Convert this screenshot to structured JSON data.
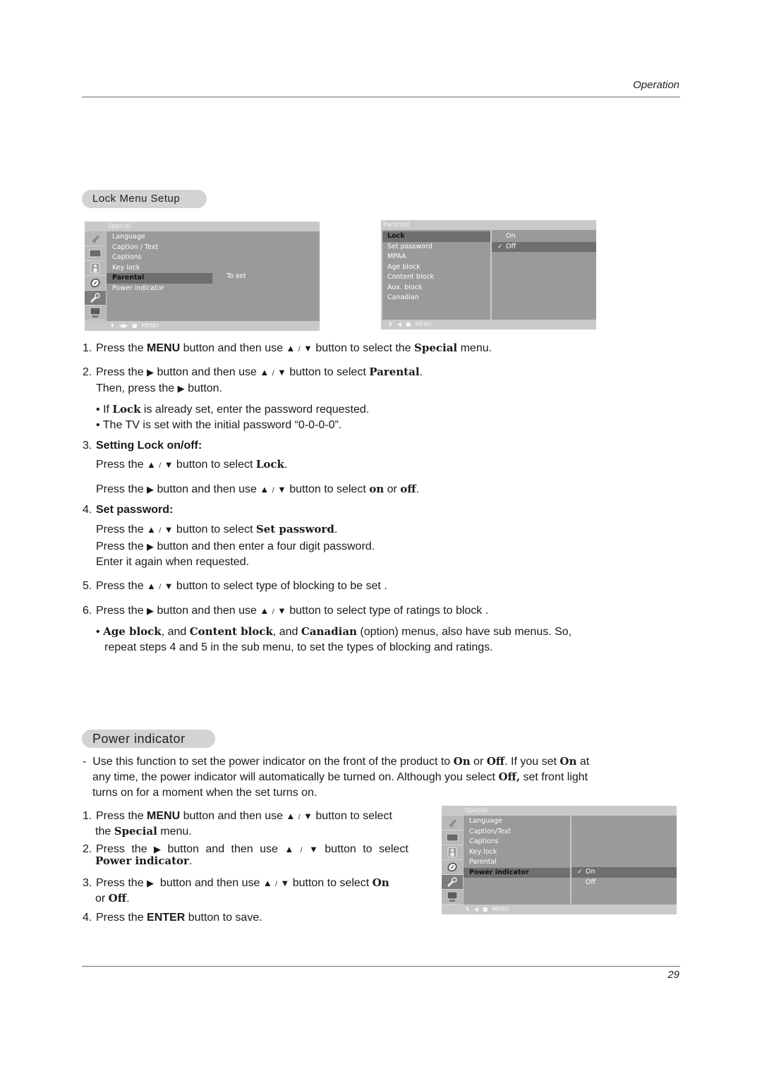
{
  "header": {
    "section": "Operation"
  },
  "footer": {
    "page_number": "29"
  },
  "lock_section": {
    "title": "Lock Menu Setup",
    "menu_special": {
      "title": "Special",
      "icons": [
        "satellite-icon",
        "picture-icon",
        "speaker-icon",
        "time-icon",
        "key-icon",
        "pc-icon"
      ],
      "active_icon_index": 4,
      "items": [
        "Language",
        "Caption / Text",
        "Captions",
        "Key lock",
        "Parental",
        "Power indicator"
      ],
      "selected_index": 4,
      "side_text": "To set",
      "footer": {
        "arrows": "◀▶",
        "stop": "■",
        "label": "MENU"
      }
    },
    "menu_parental": {
      "title": "Parental",
      "items": [
        "Lock",
        "Set password",
        "MPAA",
        "Age block",
        "Content block",
        "Aux. block",
        "Canadian"
      ],
      "selected_index": 0,
      "options": [
        "On",
        "Off"
      ],
      "checked_option_index": 1,
      "footer": {
        "arrows": "◀",
        "stop": "■",
        "label": "MENU"
      }
    },
    "steps": {
      "s1": {
        "n": "1.",
        "a": "Press the ",
        "b1": "MENU",
        "c": " button and then use ",
        "d": " button to select the ",
        "b2": "Special",
        "e": " menu."
      },
      "s2": {
        "n": "2.",
        "a": "Press the ",
        "c": " button and then use ",
        "d": " button to select ",
        "b1": "Parental",
        "e": ".",
        "l2a": "Then, press the ",
        "l2b": " button."
      },
      "bullet1": {
        "a": "If ",
        "b": "Lock",
        "c": " is already set, enter the password requested."
      },
      "bullet2": {
        "a": "The TV is set with the initial password “0-0-0-0”."
      },
      "s3": {
        "n": "3.",
        "heading": "Setting Lock on/off:",
        "l1a": "Press the ",
        "l1b": " button to select ",
        "l1c": "Lock",
        "l1d": ".",
        "l2a": "Press the ",
        "l2b": " button and then use ",
        "l2c": " button to select ",
        "on": "on",
        "or": " or ",
        "off": "off",
        "end": "."
      },
      "s4": {
        "n": "4.",
        "heading": "Set password:",
        "l1a": "Press the ",
        "l1b": " button to select ",
        "l1c": "Set password",
        "l1d": ".",
        "l2a": "Press the ",
        "l2b": " button and then enter a four digit password.",
        "l3": "Enter it again when requested."
      },
      "s5": {
        "n": "5.",
        "a": "Press the ",
        "b": " button to select type of blocking to be set ."
      },
      "s6": {
        "n": "6.",
        "a": "Press the ",
        "b": " button and then use ",
        "c": " button to select type of ratings to block ."
      },
      "bullet3": {
        "b1": "Age block",
        "a": ", and ",
        "b2": "Content block",
        "c": ", and ",
        "b3": "Canadian",
        "d": " (option) menus, also have sub menus. So,",
        "l2": "repeat steps 4 and 5 in the sub menu, to set the types of blocking and ratings."
      }
    }
  },
  "power_section": {
    "title": "Power indicator",
    "intro": {
      "dash": "-",
      "a": "Use this function to set the power indicator on the front of the product to ",
      "on": "On",
      "or": " or ",
      "off": "Off",
      "b": ". If you set ",
      "on2": "On",
      "c": " at",
      "l2a": "any time, the power indicator will automatically be turned on. Although you select ",
      "off2": "Off,",
      "l2b": " set front light",
      "l3": "turns on for a moment when the set turns on."
    },
    "steps": {
      "s1": {
        "n": "1.",
        "a": "Press the ",
        "b": "MENU",
        "c": " button and then use ",
        "d": " button to select",
        "l2a": "the ",
        "l2b": "Special",
        "l2c": " menu."
      },
      "s2": {
        "n": "2.",
        "a": "Press the ",
        "b": " button and then use ",
        "c": " button to select",
        "l2": "Power indicator",
        "l2d": "."
      },
      "s3": {
        "n": "3.",
        "a": "Press the ",
        "b": " button and then use ",
        "c": " button to select ",
        "on": "On",
        "l2a": "or ",
        "off": "Off",
        "l2b": "."
      },
      "s4": {
        "n": "4.",
        "a": "Press the ",
        "b": "ENTER",
        "c": " button to save."
      }
    },
    "menu_special": {
      "title": "Special",
      "icons": [
        "satellite-icon",
        "picture-icon",
        "speaker-icon",
        "time-icon",
        "key-icon",
        "pc-icon"
      ],
      "active_icon_index": 4,
      "items": [
        "Language",
        "Caption/Text",
        "Captions",
        "Key lock",
        "Parental",
        "Power indicator"
      ],
      "selected_index": 5,
      "options": [
        "On",
        "Off"
      ],
      "checked_option_index": 0,
      "footer": {
        "arrows": "◀",
        "stop": "■",
        "label": "MENU"
      }
    }
  },
  "glyphs": {
    "up": "▲",
    "down": "▼",
    "slash": "/",
    "right": "▶",
    "bullet": "•",
    "check": "✓",
    "updown": "⬍"
  }
}
